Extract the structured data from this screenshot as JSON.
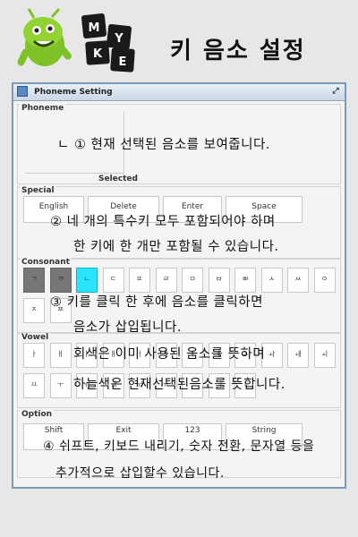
{
  "header": {
    "logo": {
      "brand_lines": [
        "MY",
        "KEY"
      ]
    },
    "title": "키 음소 설정"
  },
  "window": {
    "title": "Phoneme Setting",
    "phoneme_group": {
      "label": "Phoneme",
      "selected_label": "Selected"
    },
    "special_group": {
      "label": "Special",
      "buttons": [
        "English",
        "Delete",
        "Enter",
        "Space"
      ]
    },
    "consonant_group": {
      "label": "Consonant",
      "row1": [
        "ㄱ",
        "ㄲ",
        "ㄴ",
        "ㄷ",
        "ㄸ",
        "ㄹ",
        "ㅁ",
        "ㅂ",
        "ㅃ",
        "ㅅ",
        "ㅆ",
        "ㅇ"
      ],
      "row2": [
        "ㅈ",
        "ㅉ"
      ],
      "used_keys": [
        "ㄱ",
        "ㄲ"
      ],
      "selected_key": "ㄴ"
    },
    "vowel_group": {
      "label": "Vowel",
      "row1": [
        "ㅏ",
        "ㅐ",
        "ㅑ",
        "ㅒ",
        "ㅓ",
        "ㅔ",
        "ㅕ",
        "ㅖ",
        "ㅗ",
        "ㅘ",
        "ㅙ",
        "ㅚ"
      ],
      "row2": [
        "ㅛ",
        "ㅜ",
        "ㅝ",
        "ㅞ",
        "ㅟ",
        "ㅠ",
        "ㅡ",
        "ㅢ",
        "ㅣ"
      ]
    },
    "option_group": {
      "label": "Option",
      "buttons": [
        "Shift",
        "Exit",
        "123",
        "String"
      ]
    }
  },
  "annotations": {
    "n1": "ㄴ  ① 현재 선택된 음소를 보여줍니다.",
    "n2a": "② 네 개의 특수키 모두 포함되어야 하며",
    "n2b": "한 키에 한 개만 포함될 수 있습니다.",
    "n3a": "③ 키를 클릭 한 후에 음소를 클릭하면",
    "n3b": "음소가 삽입됩니다.",
    "n3c": "회색은 이미 사용된 음소를 뜻하며",
    "n3d": "하늘색은 현재선택된음소를 뜻합니다.",
    "n4a": "④ 쉬프트, 키보드 내리기, 숫자 전환, 문자열 등을",
    "n4b": "추가적으로 삽입할수 있습니다."
  },
  "colors": {
    "selected": "#29e3ff",
    "used": "#777777",
    "window_border": "#7c99b6"
  }
}
